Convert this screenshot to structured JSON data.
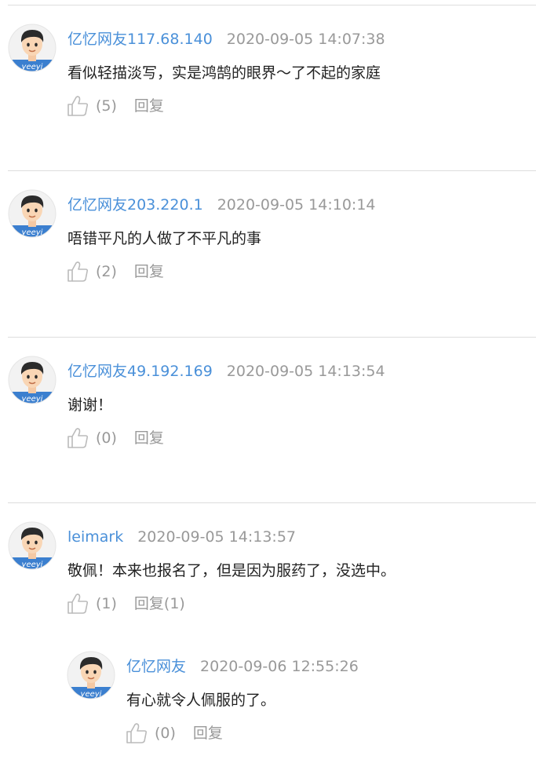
{
  "colors": {
    "username": "#4a90d9",
    "timestamp": "#999999",
    "text": "#222222",
    "divider": "#dddddd",
    "avatar_brand": "#3b7fcf"
  },
  "icons": {
    "avatar": "user-avatar-boy",
    "like": "thumbs-up-icon"
  },
  "comments": [
    {
      "username": "亿忆网友117.68.140",
      "timestamp": "2020-09-05 14:07:38",
      "content": "看似轻描淡写，实是鸿鹄的眼界～了不起的家庭",
      "likes": "(5)",
      "reply": "回复"
    },
    {
      "username": "亿忆网友203.220.1",
      "timestamp": "2020-09-05 14:10:14",
      "content": "唔错平凡的人做了不平凡的事",
      "likes": "(2)",
      "reply": "回复"
    },
    {
      "username": "亿忆网友49.192.169",
      "timestamp": "2020-09-05 14:13:54",
      "content": "谢谢！",
      "likes": "(0)",
      "reply": "回复"
    },
    {
      "username": "leimark",
      "timestamp": "2020-09-05 14:13:57",
      "content": "敬佩！本来也报名了，但是因为服药了，没选中。",
      "likes": "(1)",
      "reply": "回复(1)"
    }
  ],
  "replies": [
    {
      "username": "亿忆网友",
      "timestamp": "2020-09-06 12:55:26",
      "content": "有心就令人佩服的了。",
      "likes": "(0)",
      "reply": "回复"
    }
  ]
}
